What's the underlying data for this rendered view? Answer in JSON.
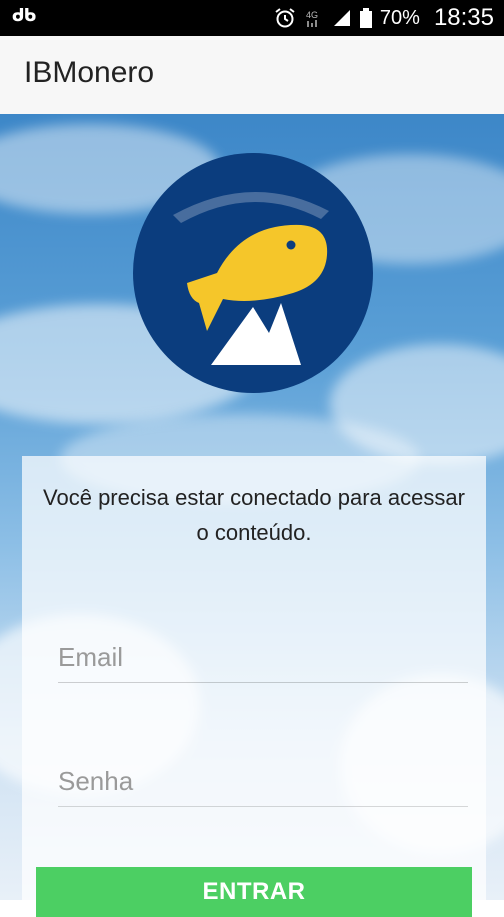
{
  "status_bar": {
    "left_icon": "db-notification-icon",
    "alarm_icon": "alarm-icon",
    "network_label": "4G",
    "signal_icon": "signal-icon",
    "battery_icon": "battery-icon",
    "battery": "70%",
    "time": "18:35"
  },
  "app_bar": {
    "title": "IBMonero"
  },
  "logo": {
    "icon": "fish-logo-icon",
    "colors": {
      "circle": "#0b3d7e",
      "fish": "#f5c62a",
      "mountain": "#ffffff"
    }
  },
  "login": {
    "message": "Você precisa estar conectado para acessar o conteúdo.",
    "email_placeholder": "Email",
    "password_placeholder": "Senha",
    "submit_label": "ENTRAR"
  },
  "colors": {
    "status_bar": "#000000",
    "app_bar": "#f7f7f7",
    "button": "#4ccf63"
  }
}
